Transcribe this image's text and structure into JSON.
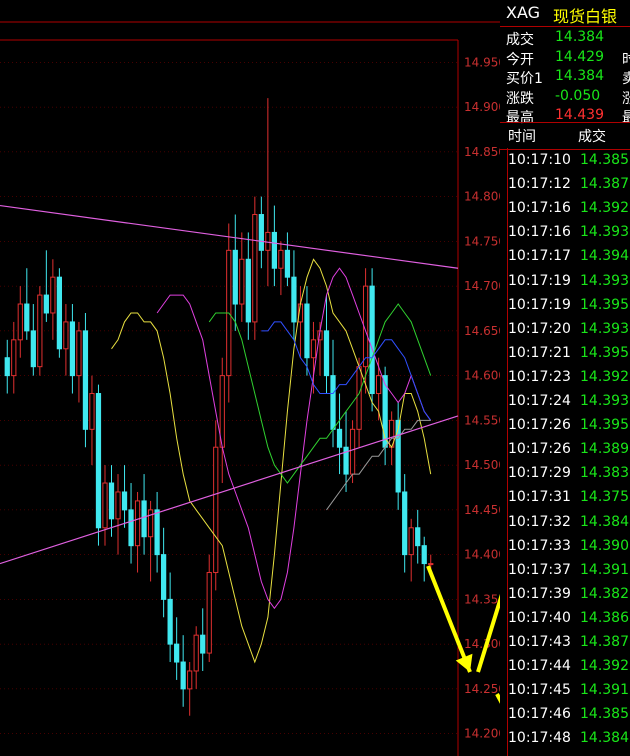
{
  "colors": {
    "up": "#e03030",
    "down": "#40e8f0",
    "ma_yellow": "#e8e040",
    "ma_magenta": "#e040e0",
    "ma_green": "#30d030",
    "ma_blue": "#3050ff",
    "ma_gray": "#9a9a9a",
    "trendline": "#e060e0",
    "arrow": "#ffff00",
    "axis_text": "#c83030",
    "tick_price": "#19e619"
  },
  "header": {
    "code": "XAG",
    "name": "现货白银"
  },
  "quote": [
    {
      "label": "成交",
      "value": "14.384",
      "color": "#19e619",
      "cut": ""
    },
    {
      "label": "今开",
      "value": "14.429",
      "color": "#19e619",
      "cut": "时"
    },
    {
      "label": "买价1",
      "value": "14.384",
      "color": "#19e619",
      "cut": "卖"
    },
    {
      "label": "涨跌",
      "value": "-0.050",
      "color": "#19e619",
      "cut": "涨"
    },
    {
      "label": "最高",
      "value": "14.439",
      "color": "#ff3030",
      "cut": "最"
    }
  ],
  "ticks_header": {
    "time": "时间",
    "price": "成交"
  },
  "ticks": [
    {
      "time": "10:17:10",
      "price": "14.385"
    },
    {
      "time": "10:17:12",
      "price": "14.387"
    },
    {
      "time": "10:17:16",
      "price": "14.392"
    },
    {
      "time": "10:17:16",
      "price": "14.393"
    },
    {
      "time": "10:17:17",
      "price": "14.394"
    },
    {
      "time": "10:17:19",
      "price": "14.393"
    },
    {
      "time": "10:17:19",
      "price": "14.395"
    },
    {
      "time": "10:17:20",
      "price": "14.393"
    },
    {
      "time": "10:17:21",
      "price": "14.395"
    },
    {
      "time": "10:17:23",
      "price": "14.392"
    },
    {
      "time": "10:17:24",
      "price": "14.393"
    },
    {
      "time": "10:17:26",
      "price": "14.395"
    },
    {
      "time": "10:17:26",
      "price": "14.389"
    },
    {
      "time": "10:17:29",
      "price": "14.383"
    },
    {
      "time": "10:17:31",
      "price": "14.375"
    },
    {
      "time": "10:17:32",
      "price": "14.384"
    },
    {
      "time": "10:17:33",
      "price": "14.390"
    },
    {
      "time": "10:17:37",
      "price": "14.391"
    },
    {
      "time": "10:17:39",
      "price": "14.382"
    },
    {
      "time": "10:17:40",
      "price": "14.386"
    },
    {
      "time": "10:17:43",
      "price": "14.387"
    },
    {
      "time": "10:17:44",
      "price": "14.392"
    },
    {
      "time": "10:17:45",
      "price": "14.391"
    },
    {
      "time": "10:17:46",
      "price": "14.385"
    },
    {
      "time": "10:17:48",
      "price": "14.384"
    }
  ],
  "chart_data": {
    "type": "candlestick",
    "y_ticks": [
      "14.950",
      "14.900",
      "14.850",
      "14.800",
      "14.750",
      "14.700",
      "14.650",
      "14.600",
      "14.550",
      "14.500",
      "14.450",
      "14.400",
      "14.350",
      "14.300",
      "14.250",
      "14.200"
    ],
    "ylim": [
      14.175,
      14.975
    ],
    "candles": [
      {
        "o": 14.62,
        "h": 14.64,
        "l": 14.58,
        "c": 14.6
      },
      {
        "o": 14.6,
        "h": 14.66,
        "l": 14.58,
        "c": 14.64
      },
      {
        "o": 14.64,
        "h": 14.7,
        "l": 14.62,
        "c": 14.68
      },
      {
        "o": 14.68,
        "h": 14.72,
        "l": 14.64,
        "c": 14.65
      },
      {
        "o": 14.65,
        "h": 14.68,
        "l": 14.6,
        "c": 14.61
      },
      {
        "o": 14.61,
        "h": 14.7,
        "l": 14.6,
        "c": 14.69
      },
      {
        "o": 14.69,
        "h": 14.74,
        "l": 14.66,
        "c": 14.67
      },
      {
        "o": 14.67,
        "h": 14.73,
        "l": 14.64,
        "c": 14.71
      },
      {
        "o": 14.71,
        "h": 14.72,
        "l": 14.62,
        "c": 14.63
      },
      {
        "o": 14.63,
        "h": 14.68,
        "l": 14.6,
        "c": 14.66
      },
      {
        "o": 14.66,
        "h": 14.68,
        "l": 14.58,
        "c": 14.6
      },
      {
        "o": 14.6,
        "h": 14.66,
        "l": 14.57,
        "c": 14.65
      },
      {
        "o": 14.65,
        "h": 14.67,
        "l": 14.52,
        "c": 14.54
      },
      {
        "o": 14.54,
        "h": 14.6,
        "l": 14.5,
        "c": 14.58
      },
      {
        "o": 14.58,
        "h": 14.59,
        "l": 14.41,
        "c": 14.43
      },
      {
        "o": 14.43,
        "h": 14.5,
        "l": 14.41,
        "c": 14.48
      },
      {
        "o": 14.48,
        "h": 14.5,
        "l": 14.42,
        "c": 14.44
      },
      {
        "o": 14.44,
        "h": 14.49,
        "l": 14.4,
        "c": 14.47
      },
      {
        "o": 14.47,
        "h": 14.5,
        "l": 14.43,
        "c": 14.45
      },
      {
        "o": 14.45,
        "h": 14.48,
        "l": 14.39,
        "c": 14.41
      },
      {
        "o": 14.41,
        "h": 14.47,
        "l": 14.38,
        "c": 14.46
      },
      {
        "o": 14.46,
        "h": 14.49,
        "l": 14.4,
        "c": 14.42
      },
      {
        "o": 14.42,
        "h": 14.46,
        "l": 14.37,
        "c": 14.45
      },
      {
        "o": 14.45,
        "h": 14.47,
        "l": 14.38,
        "c": 14.4
      },
      {
        "o": 14.4,
        "h": 14.43,
        "l": 14.33,
        "c": 14.35
      },
      {
        "o": 14.35,
        "h": 14.38,
        "l": 14.28,
        "c": 14.3
      },
      {
        "o": 14.3,
        "h": 14.33,
        "l": 14.26,
        "c": 14.28
      },
      {
        "o": 14.28,
        "h": 14.31,
        "l": 14.23,
        "c": 14.25
      },
      {
        "o": 14.25,
        "h": 14.28,
        "l": 14.22,
        "c": 14.27
      },
      {
        "o": 14.27,
        "h": 14.32,
        "l": 14.25,
        "c": 14.31
      },
      {
        "o": 14.31,
        "h": 14.34,
        "l": 14.27,
        "c": 14.29
      },
      {
        "o": 14.29,
        "h": 14.4,
        "l": 14.28,
        "c": 14.38
      },
      {
        "o": 14.38,
        "h": 14.55,
        "l": 14.36,
        "c": 14.52
      },
      {
        "o": 14.52,
        "h": 14.62,
        "l": 14.48,
        "c": 14.6
      },
      {
        "o": 14.6,
        "h": 14.77,
        "l": 14.57,
        "c": 14.74
      },
      {
        "o": 14.74,
        "h": 14.78,
        "l": 14.65,
        "c": 14.68
      },
      {
        "o": 14.68,
        "h": 14.76,
        "l": 14.66,
        "c": 14.73
      },
      {
        "o": 14.73,
        "h": 14.76,
        "l": 14.64,
        "c": 14.66
      },
      {
        "o": 14.66,
        "h": 14.8,
        "l": 14.64,
        "c": 14.78
      },
      {
        "o": 14.78,
        "h": 14.8,
        "l": 14.72,
        "c": 14.74
      },
      {
        "o": 14.74,
        "h": 14.91,
        "l": 14.7,
        "c": 14.76
      },
      {
        "o": 14.76,
        "h": 14.79,
        "l": 14.7,
        "c": 14.72
      },
      {
        "o": 14.72,
        "h": 14.75,
        "l": 14.69,
        "c": 14.74
      },
      {
        "o": 14.74,
        "h": 14.76,
        "l": 14.7,
        "c": 14.71
      },
      {
        "o": 14.71,
        "h": 14.74,
        "l": 14.64,
        "c": 14.66
      },
      {
        "o": 14.66,
        "h": 14.7,
        "l": 14.62,
        "c": 14.68
      },
      {
        "o": 14.68,
        "h": 14.7,
        "l": 14.6,
        "c": 14.62
      },
      {
        "o": 14.62,
        "h": 14.66,
        "l": 14.58,
        "c": 14.64
      },
      {
        "o": 14.64,
        "h": 14.66,
        "l": 14.6,
        "c": 14.65
      },
      {
        "o": 14.65,
        "h": 14.69,
        "l": 14.58,
        "c": 14.6
      },
      {
        "o": 14.6,
        "h": 14.64,
        "l": 14.52,
        "c": 14.54
      },
      {
        "o": 14.54,
        "h": 14.58,
        "l": 14.49,
        "c": 14.52
      },
      {
        "o": 14.52,
        "h": 14.56,
        "l": 14.47,
        "c": 14.49
      },
      {
        "o": 14.49,
        "h": 14.55,
        "l": 14.48,
        "c": 14.54
      },
      {
        "o": 14.54,
        "h": 14.62,
        "l": 14.52,
        "c": 14.61
      },
      {
        "o": 14.61,
        "h": 14.72,
        "l": 14.58,
        "c": 14.7
      },
      {
        "o": 14.7,
        "h": 14.72,
        "l": 14.56,
        "c": 14.58
      },
      {
        "o": 14.58,
        "h": 14.62,
        "l": 14.55,
        "c": 14.6
      },
      {
        "o": 14.6,
        "h": 14.61,
        "l": 14.5,
        "c": 14.52
      },
      {
        "o": 14.52,
        "h": 14.56,
        "l": 14.5,
        "c": 14.55
      },
      {
        "o": 14.55,
        "h": 14.57,
        "l": 14.45,
        "c": 14.47
      },
      {
        "o": 14.47,
        "h": 14.49,
        "l": 14.38,
        "c": 14.4
      },
      {
        "o": 14.4,
        "h": 14.44,
        "l": 14.37,
        "c": 14.43
      },
      {
        "o": 14.43,
        "h": 14.45,
        "l": 14.39,
        "c": 14.41
      },
      {
        "o": 14.41,
        "h": 14.42,
        "l": 14.37,
        "c": 14.39
      },
      {
        "o": 14.39,
        "h": 14.4,
        "l": 14.38,
        "c": 14.39
      }
    ],
    "ma_lines": [
      {
        "name_color": "ma_yellow",
        "values": [
          14.63,
          14.64,
          14.66,
          14.67,
          14.67,
          14.66,
          14.66,
          14.65,
          14.62,
          14.58,
          14.53,
          14.49,
          14.46,
          14.45,
          14.44,
          14.43,
          14.42,
          14.41,
          14.38,
          14.35,
          14.32,
          14.3,
          14.28,
          14.3,
          14.33,
          14.4,
          14.48,
          14.56,
          14.63,
          14.68,
          14.71,
          14.73,
          14.72,
          14.7,
          14.67,
          14.66,
          14.65,
          14.63,
          14.61,
          14.59,
          14.57,
          14.56,
          14.53,
          14.52,
          14.54,
          14.58,
          14.58,
          14.56,
          14.53,
          14.49
        ]
      },
      {
        "name_color": "ma_magenta",
        "values": [
          14.67,
          14.68,
          14.69,
          14.69,
          14.69,
          14.68,
          14.66,
          14.64,
          14.6,
          14.56,
          14.52,
          14.49,
          14.47,
          14.45,
          14.43,
          14.4,
          14.37,
          14.35,
          14.34,
          14.35,
          14.38,
          14.43,
          14.49,
          14.55,
          14.6,
          14.65,
          14.69,
          14.71,
          14.72,
          14.71,
          14.69,
          14.67,
          14.65,
          14.63,
          14.61,
          14.59,
          14.58,
          14.57,
          14.58,
          14.6,
          14.58,
          14.56,
          14.55
        ]
      },
      {
        "name_color": "ma_green",
        "values": [
          14.66,
          14.67,
          14.67,
          14.67,
          14.66,
          14.64,
          14.61,
          14.58,
          14.55,
          14.52,
          14.5,
          14.49,
          14.48,
          14.49,
          14.5,
          14.51,
          14.52,
          14.53,
          14.53,
          14.54,
          14.55,
          14.56,
          14.57,
          14.58,
          14.6,
          14.62,
          14.64,
          14.66,
          14.67,
          14.68,
          14.67,
          14.66,
          14.64,
          14.62,
          14.6
        ]
      },
      {
        "name_color": "ma_blue",
        "values": [
          14.65,
          14.65,
          14.66,
          14.66,
          14.65,
          14.64,
          14.62,
          14.61,
          14.59,
          14.58,
          14.58,
          14.58,
          14.59,
          14.59,
          14.6,
          14.61,
          14.62,
          14.62,
          14.63,
          14.64,
          14.64,
          14.63,
          14.62,
          14.6,
          14.58,
          14.56,
          14.55
        ]
      },
      {
        "name_color": "ma_gray",
        "values": [
          14.45,
          14.46,
          14.47,
          14.48,
          14.49,
          14.49,
          14.5,
          14.51,
          14.51,
          14.52,
          14.53,
          14.53,
          14.54,
          14.54,
          14.55,
          14.55,
          14.55
        ]
      }
    ],
    "trendlines": [
      {
        "from": [
          0,
          14.79
        ],
        "to": [
          1,
          14.72
        ]
      },
      {
        "from": [
          0,
          14.39
        ],
        "to": [
          1,
          14.555
        ]
      }
    ]
  }
}
